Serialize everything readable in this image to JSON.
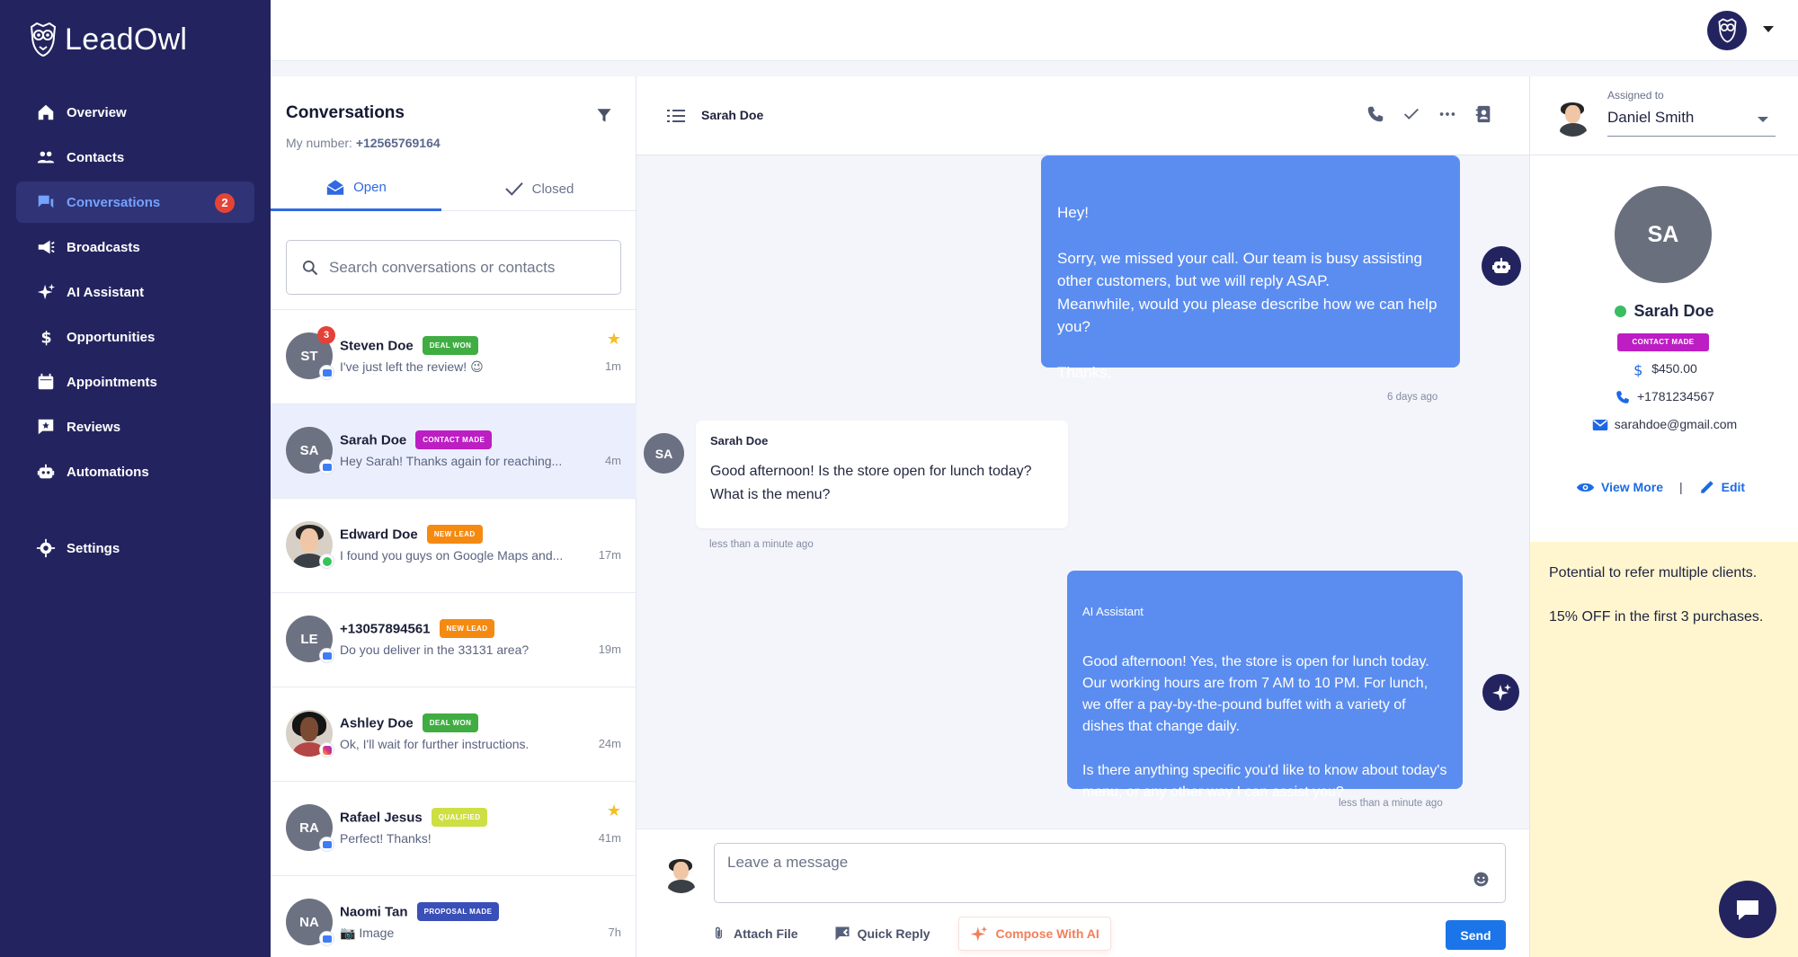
{
  "app": {
    "logo_text": "LeadOwl"
  },
  "sidebar": {
    "items": [
      {
        "label": "Overview",
        "icon": "home-icon"
      },
      {
        "label": "Contacts",
        "icon": "people-icon"
      },
      {
        "label": "Conversations",
        "icon": "chat-icon",
        "badge": "2",
        "active": true
      },
      {
        "label": "Broadcasts",
        "icon": "megaphone-icon"
      },
      {
        "label": "AI Assistant",
        "icon": "sparkle-icon"
      },
      {
        "label": "Opportunities",
        "icon": "dollar-icon"
      },
      {
        "label": "Appointments",
        "icon": "calendar-icon"
      },
      {
        "label": "Reviews",
        "icon": "review-icon"
      },
      {
        "label": "Automations",
        "icon": "robot-icon"
      }
    ],
    "settings_label": "Settings"
  },
  "conversations": {
    "title": "Conversations",
    "my_number_label": "My number:",
    "my_number": "+12565769164",
    "tabs": {
      "open": "Open",
      "closed": "Closed"
    },
    "search_placeholder": "Search conversations or contacts",
    "items": [
      {
        "initials": "ST",
        "name": "Steven Doe",
        "tag": "DEAL WON",
        "message": "I've just left the review! 😉",
        "time": "1m",
        "unread": "3",
        "starred": true,
        "channel": "messenger"
      },
      {
        "initials": "SA",
        "name": "Sarah Doe",
        "tag": "CONTACT MADE",
        "message": "Hey Sarah! Thanks again for reaching...",
        "time": "4m",
        "selected": true,
        "channel": "messenger"
      },
      {
        "initials": "",
        "name": "Edward Doe",
        "tag": "NEW LEAD",
        "message": "I found you guys on Google Maps and...",
        "time": "17m",
        "channel": "whatsapp"
      },
      {
        "initials": "LE",
        "name": "+13057894561",
        "tag": "NEW LEAD",
        "message": "Do you deliver in the 33131 area?",
        "time": "19m",
        "channel": "messenger"
      },
      {
        "initials": "",
        "name": "Ashley Doe",
        "tag": "DEAL WON",
        "message": "Ok, I'll wait for further instructions.",
        "time": "24m",
        "channel": "instagram"
      },
      {
        "initials": "RA",
        "name": "Rafael Jesus",
        "tag": "QUALIFIED",
        "message": "Perfect! Thanks!",
        "time": "41m",
        "starred": true,
        "channel": "messenger"
      },
      {
        "initials": "NA",
        "name": "Naomi Tan",
        "tag": "PROPOSAL MADE",
        "message": "📷 Image",
        "time": "7h",
        "channel": "messenger"
      }
    ]
  },
  "chat": {
    "contact_name": "Sarah Doe",
    "messages": [
      {
        "type": "outgoing",
        "text": "Hey!\n\nSorry, we missed your call. Our team is busy assisting other customers, but we will reply ASAP.\nMeanwhile, would you please describe how we can help you?\n\nThanks.",
        "time": "6 days ago"
      },
      {
        "type": "incoming",
        "sender": "Sarah Doe",
        "avatar": "SA",
        "text": "Good afternoon! Is the store open for lunch today? What is the menu?",
        "time": "less than a minute ago"
      },
      {
        "type": "ai",
        "sender": "AI Assistant",
        "text": "Good afternoon! Yes, the store is open for lunch today. Our working hours are from 7 AM to 10 PM. For lunch, we offer a pay-by-the-pound buffet with a variety of dishes that change daily.\n\nIs there anything specific you'd like to know about today's menu, or any other way I can assist you?",
        "time": "less than a minute ago"
      }
    ],
    "composer": {
      "placeholder": "Leave a message",
      "attach_label": "Attach File",
      "quick_reply_label": "Quick Reply",
      "compose_ai_label": "Compose With AI",
      "send_label": "Send"
    }
  },
  "contact_panel": {
    "assigned_label": "Assigned to",
    "assigned_to": "Daniel Smith",
    "initials": "SA",
    "name": "Sarah Doe",
    "tag": "CONTACT MADE",
    "amount": "$450.00",
    "phone": "+1781234567",
    "email": "sarahdoe@gmail.com",
    "view_more_label": "View More",
    "separator": "|",
    "edit_label": "Edit",
    "note": [
      "Potential to refer multiple clients.",
      "15% OFF in the first 3 purchases."
    ]
  },
  "colors": {
    "sidebar": "#23245f",
    "accent": "#2f69e3",
    "bubble": "#5b8df0",
    "note": "#fff6cf"
  }
}
